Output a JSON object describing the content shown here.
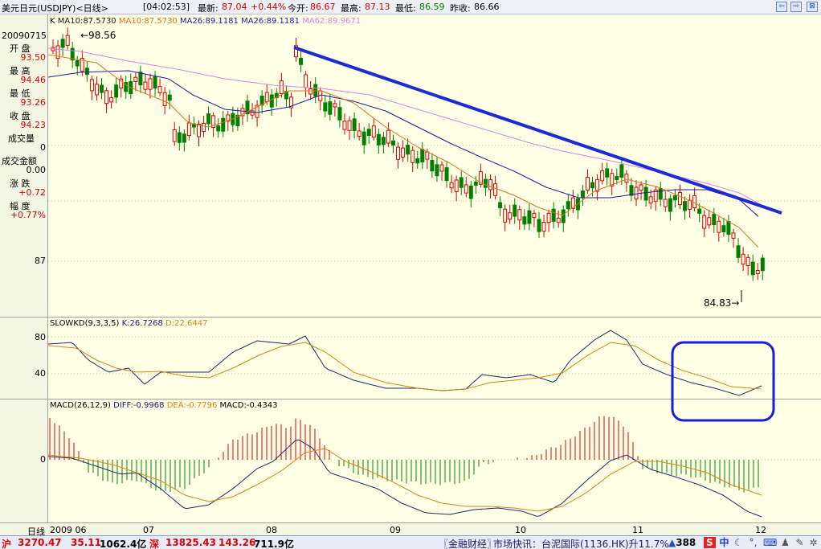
{
  "titlebar": {
    "instrument": "美元日元(USDJPY)<日线>",
    "time": "[04:02:53]",
    "latest_label": "最新:",
    "latest_value": "87.04",
    "change_pct": "+0.44%",
    "open_label": "今开:",
    "open_value": "86.67",
    "high_label": "最高:",
    "high_value": "87.13",
    "low_label": "最低:",
    "low_value": "86.59",
    "prev_close_label": "昨收:",
    "prev_close_value": "86.66"
  },
  "left_panel": {
    "date": "20090715",
    "open_label": "开 盘",
    "open_value": "93.50",
    "high_label": "最 高",
    "high_value": "94.46",
    "low_label": "最 低",
    "low_value": "93.26",
    "close_label": "收 盘",
    "close_value": "94.23",
    "volume_label": "成交量",
    "volume_value": "0",
    "amount_label": "成交金额",
    "amount_value": "0.00",
    "change_label": "涨 跌",
    "change_value": "+0.72",
    "range_label": "幅 度",
    "range_value": "+0.77%",
    "price_tick": "87",
    "kd_tick_80": "80",
    "kd_tick_40": "40",
    "macd_tick_0": "0"
  },
  "legends": {
    "price": {
      "k": "K",
      "ma10_a": "MA10:87.5730",
      "ma10_b": "MA10:87.5730",
      "ma26_a": "MA26:89.1181",
      "ma26_b": "MA26:89.1181",
      "ma62": "MA62:89.9671"
    },
    "kd": {
      "name": "SLOWKD(9,3,3,5)",
      "k": "K:26.7268",
      "d": "D:22.6447"
    },
    "macd": {
      "name": "MACD(26,12,9)",
      "diff": "DIFF:-0.9968",
      "dea": "DEA:-0.7796",
      "macd": "MACD:-0.4343"
    }
  },
  "annotations": {
    "high_marker": "←98.56",
    "low_marker": "84.83→"
  },
  "datebar": {
    "label": "日线",
    "ticks": [
      "2009 06",
      "07",
      "08",
      "09",
      "10",
      "11",
      "12"
    ]
  },
  "statusbar": {
    "sh_label": "沪",
    "sh_index": "3270.47",
    "sh_change": "35.11",
    "sh_amount": "1062.4亿",
    "sz_label": "深",
    "sz_index": "13825.43",
    "sz_change": "143.26",
    "sz_amount": "711.9亿",
    "news_source": "〖金融财经〗",
    "news_text": "市场快讯：台泥国际(1136.HK)升11.7%",
    "badge_count": "388",
    "ime_label": "中"
  },
  "colors": {
    "up": "#e00000",
    "down": "#008000",
    "ma10": "#e07020",
    "ma26": "#1a1aa0",
    "ma62": "#e080e0",
    "trendline": "#1a2ad8",
    "highlight_box": "#1a1ae0",
    "chart_bg": "#ffffe6"
  }
}
